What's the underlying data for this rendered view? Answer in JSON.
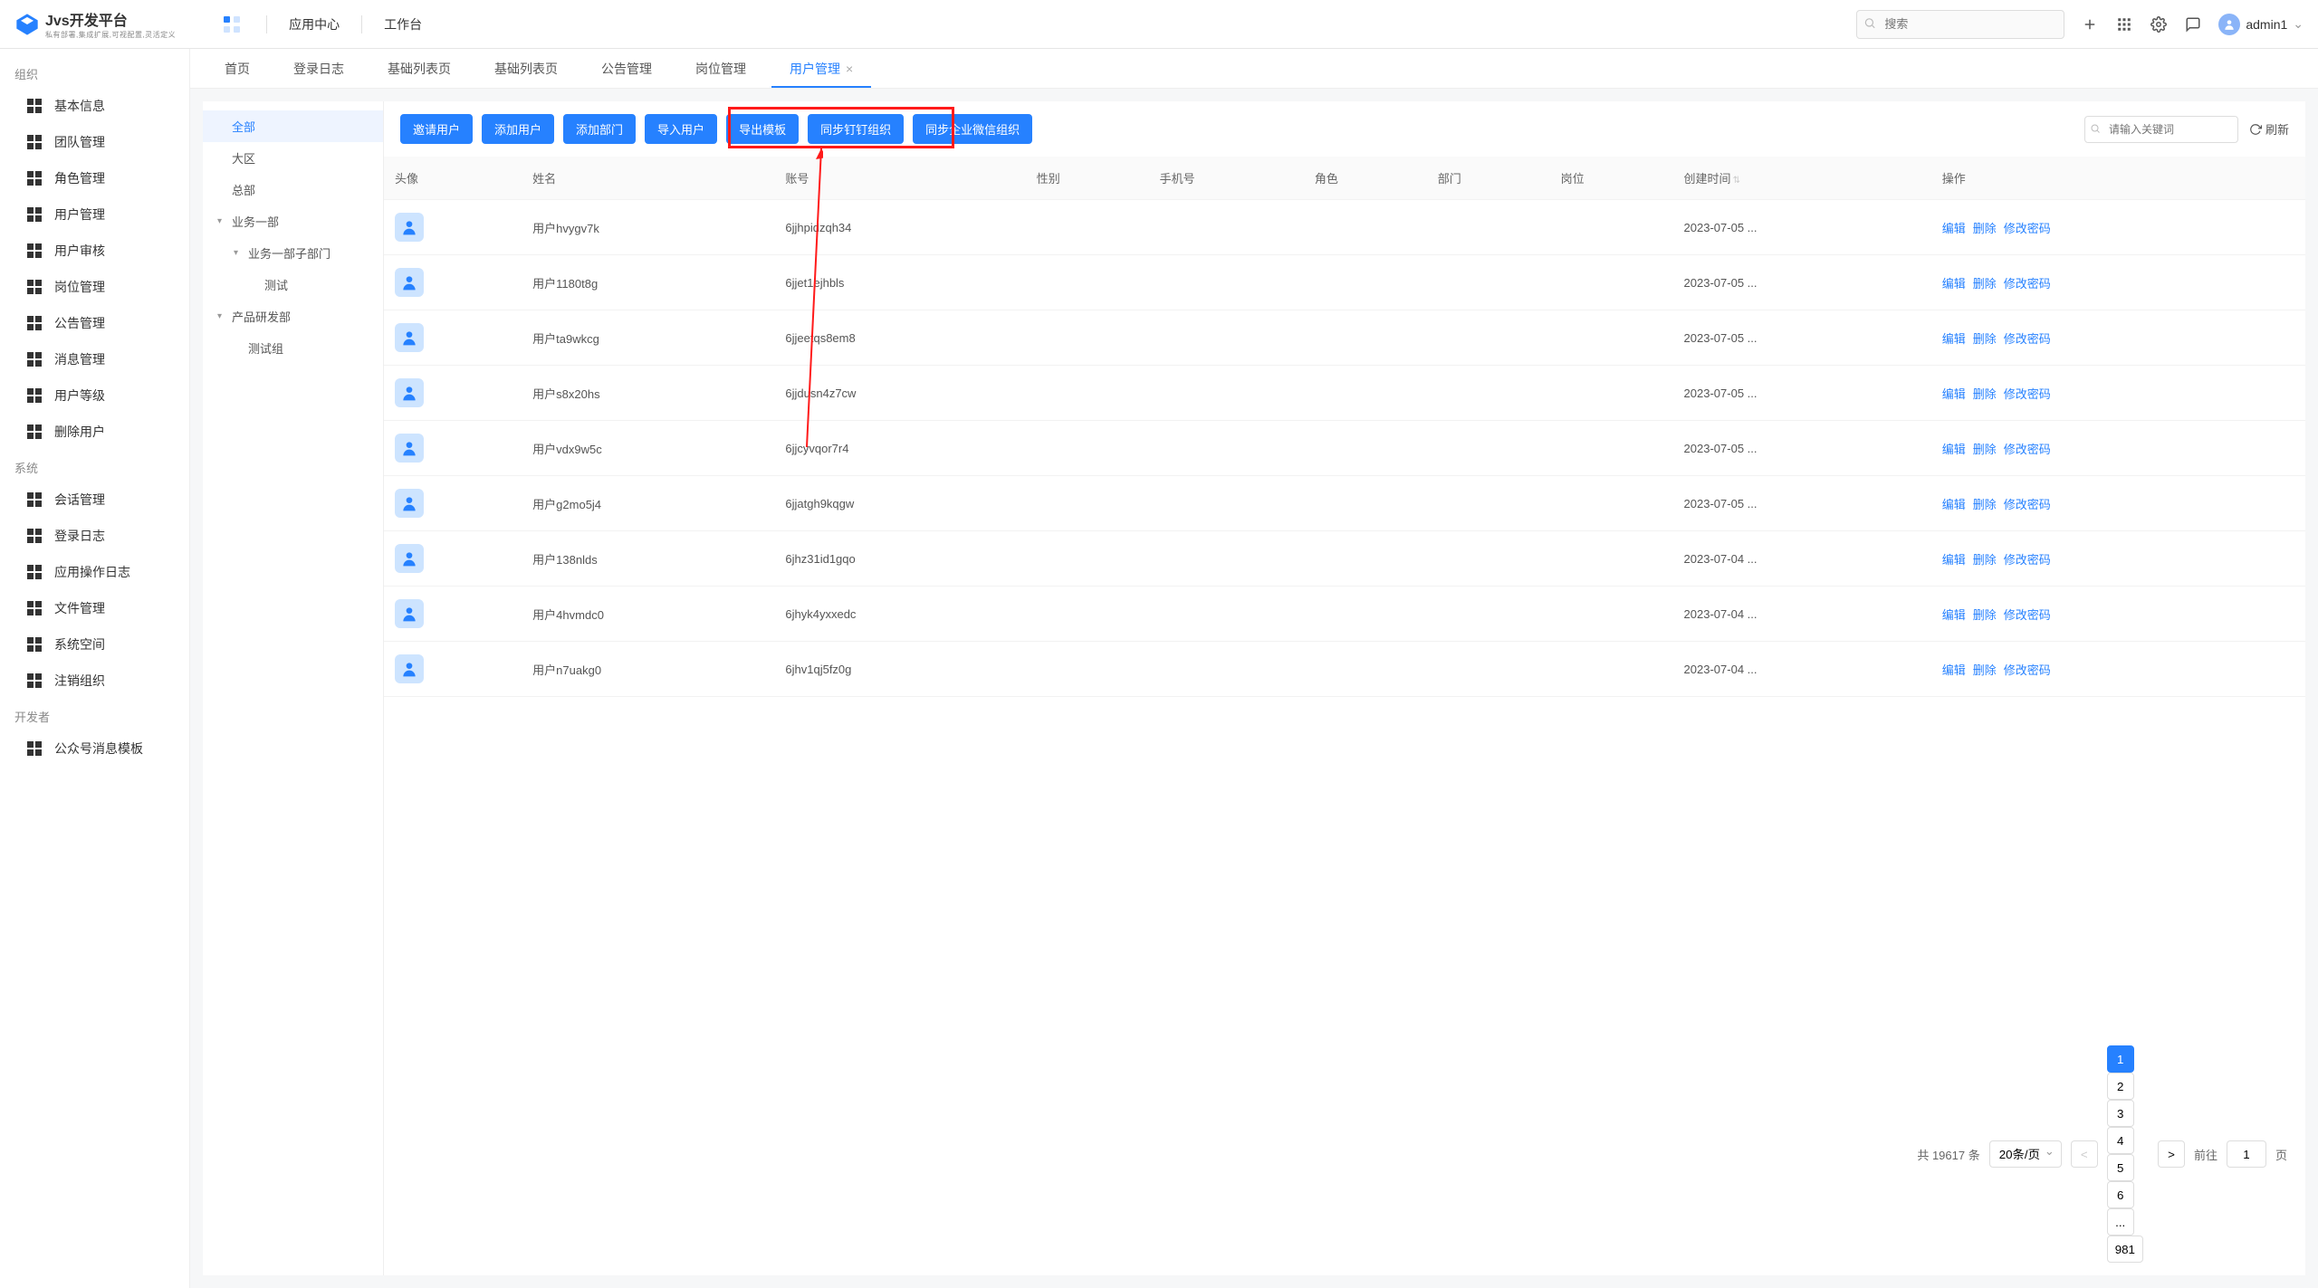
{
  "header": {
    "logo_title": "Jvs开发平台",
    "logo_sub": "私有部署,集成扩展,可视配置,灵活定义",
    "nav": {
      "app_center": "应用中心",
      "workbench": "工作台"
    },
    "search_placeholder": "搜索",
    "username": "admin1"
  },
  "sidebar": {
    "groups": [
      {
        "title": "组织",
        "items": [
          "基本信息",
          "团队管理",
          "角色管理",
          "用户管理",
          "用户审核",
          "岗位管理",
          "公告管理",
          "消息管理",
          "用户等级",
          "删除用户"
        ]
      },
      {
        "title": "系统",
        "items": [
          "会话管理",
          "登录日志",
          "应用操作日志",
          "文件管理",
          "系统空间",
          "注销组织"
        ]
      },
      {
        "title": "开发者",
        "items": [
          "公众号消息模板"
        ]
      }
    ]
  },
  "tabs": [
    {
      "label": "首页",
      "closeable": false
    },
    {
      "label": "登录日志",
      "closeable": false
    },
    {
      "label": "基础列表页",
      "closeable": false
    },
    {
      "label": "基础列表页",
      "closeable": false
    },
    {
      "label": "公告管理",
      "closeable": false
    },
    {
      "label": "岗位管理",
      "closeable": false
    },
    {
      "label": "用户管理",
      "closeable": true,
      "active": true
    }
  ],
  "tree": [
    {
      "label": "全部",
      "depth": 0,
      "active": true
    },
    {
      "label": "大区",
      "depth": 0
    },
    {
      "label": "总部",
      "depth": 0
    },
    {
      "label": "业务一部",
      "depth": 0,
      "expand": true
    },
    {
      "label": "业务一部子部门",
      "depth": 1,
      "expand": true
    },
    {
      "label": "测试",
      "depth": 2
    },
    {
      "label": "产品研发部",
      "depth": 0,
      "expand": true
    },
    {
      "label": "测试组",
      "depth": 1
    }
  ],
  "toolbar": {
    "buttons": [
      "邀请用户",
      "添加用户",
      "添加部门",
      "导入用户",
      "导出模板",
      "同步钉钉组织",
      "同步企业微信组织"
    ],
    "filter_placeholder": "请输入关键词",
    "refresh": "刷新"
  },
  "columns": [
    "头像",
    "姓名",
    "账号",
    "性别",
    "手机号",
    "角色",
    "部门",
    "岗位",
    "创建时间",
    "操作"
  ],
  "ops": {
    "edit": "编辑",
    "delete": "删除",
    "reset_pw": "修改密码"
  },
  "rows": [
    {
      "name": "用户hvygv7k",
      "account": "6jjhpidzqh34",
      "created": "2023-07-05 ..."
    },
    {
      "name": "用户1180t8g",
      "account": "6jjet1ejhbls",
      "created": "2023-07-05 ..."
    },
    {
      "name": "用户ta9wkcg",
      "account": "6jjeetqs8em8",
      "created": "2023-07-05 ..."
    },
    {
      "name": "用户s8x20hs",
      "account": "6jjdusn4z7cw",
      "created": "2023-07-05 ..."
    },
    {
      "name": "用户vdx9w5c",
      "account": "6jjcyvqor7r4",
      "created": "2023-07-05 ..."
    },
    {
      "name": "用户g2mo5j4",
      "account": "6jjatgh9kqgw",
      "created": "2023-07-05 ..."
    },
    {
      "name": "用户138nlds",
      "account": "6jhz31id1gqo",
      "created": "2023-07-04 ..."
    },
    {
      "name": "用户4hvmdc0",
      "account": "6jhyk4yxxedc",
      "created": "2023-07-04 ..."
    },
    {
      "name": "用户n7uakg0",
      "account": "6jhv1qj5fz0g",
      "created": "2023-07-04 ..."
    }
  ],
  "pager": {
    "total_label": "共 19617 条",
    "page_size": "20条/页",
    "pages": [
      "1",
      "2",
      "3",
      "4",
      "5",
      "6",
      "...",
      "981"
    ],
    "current": 1,
    "goto_label": "前往",
    "goto_value": "1",
    "page_suffix": "页"
  }
}
